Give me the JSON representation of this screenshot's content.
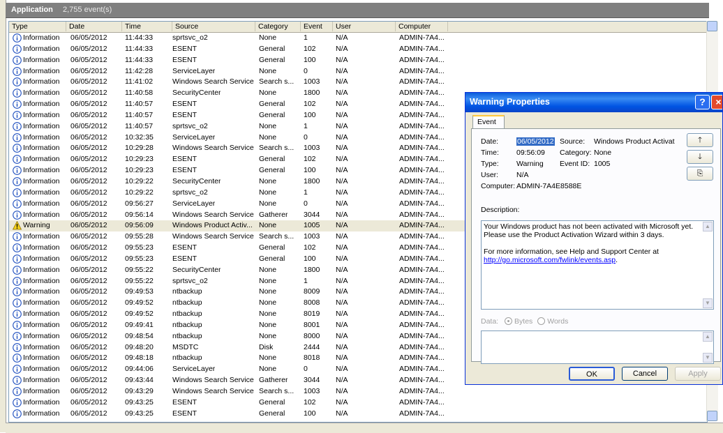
{
  "window": {
    "title": "Application",
    "count": "2,755 event(s)"
  },
  "columns": [
    "Type",
    "Date",
    "Time",
    "Source",
    "Category",
    "Event",
    "User",
    "Computer"
  ],
  "rows": [
    [
      "Information",
      "06/05/2012",
      "11:44:33",
      "sprtsvc_o2",
      "None",
      "1",
      "N/A",
      "ADMIN-7A4..."
    ],
    [
      "Information",
      "06/05/2012",
      "11:44:33",
      "ESENT",
      "General",
      "102",
      "N/A",
      "ADMIN-7A4..."
    ],
    [
      "Information",
      "06/05/2012",
      "11:44:33",
      "ESENT",
      "General",
      "100",
      "N/A",
      "ADMIN-7A4..."
    ],
    [
      "Information",
      "06/05/2012",
      "11:42:28",
      "ServiceLayer",
      "None",
      "0",
      "N/A",
      "ADMIN-7A4..."
    ],
    [
      "Information",
      "06/05/2012",
      "11:41:02",
      "Windows Search Service",
      "Search s...",
      "1003",
      "N/A",
      "ADMIN-7A4..."
    ],
    [
      "Information",
      "06/05/2012",
      "11:40:58",
      "SecurityCenter",
      "None",
      "1800",
      "N/A",
      "ADMIN-7A4..."
    ],
    [
      "Information",
      "06/05/2012",
      "11:40:57",
      "ESENT",
      "General",
      "102",
      "N/A",
      "ADMIN-7A4..."
    ],
    [
      "Information",
      "06/05/2012",
      "11:40:57",
      "ESENT",
      "General",
      "100",
      "N/A",
      "ADMIN-7A4..."
    ],
    [
      "Information",
      "06/05/2012",
      "11:40:57",
      "sprtsvc_o2",
      "None",
      "1",
      "N/A",
      "ADMIN-7A4..."
    ],
    [
      "Information",
      "06/05/2012",
      "10:32:35",
      "ServiceLayer",
      "None",
      "0",
      "N/A",
      "ADMIN-7A4..."
    ],
    [
      "Information",
      "06/05/2012",
      "10:29:28",
      "Windows Search Service",
      "Search s...",
      "1003",
      "N/A",
      "ADMIN-7A4..."
    ],
    [
      "Information",
      "06/05/2012",
      "10:29:23",
      "ESENT",
      "General",
      "102",
      "N/A",
      "ADMIN-7A4..."
    ],
    [
      "Information",
      "06/05/2012",
      "10:29:23",
      "ESENT",
      "General",
      "100",
      "N/A",
      "ADMIN-7A4..."
    ],
    [
      "Information",
      "06/05/2012",
      "10:29:22",
      "SecurityCenter",
      "None",
      "1800",
      "N/A",
      "ADMIN-7A4..."
    ],
    [
      "Information",
      "06/05/2012",
      "10:29:22",
      "sprtsvc_o2",
      "None",
      "1",
      "N/A",
      "ADMIN-7A4..."
    ],
    [
      "Information",
      "06/05/2012",
      "09:56:27",
      "ServiceLayer",
      "None",
      "0",
      "N/A",
      "ADMIN-7A4..."
    ],
    [
      "Information",
      "06/05/2012",
      "09:56:14",
      "Windows Search Service",
      "Gatherer",
      "3044",
      "N/A",
      "ADMIN-7A4..."
    ],
    [
      "Warning",
      "06/05/2012",
      "09:56:09",
      "Windows Product Activ...",
      "None",
      "1005",
      "N/A",
      "ADMIN-7A4..."
    ],
    [
      "Information",
      "06/05/2012",
      "09:55:28",
      "Windows Search Service",
      "Search s...",
      "1003",
      "N/A",
      "ADMIN-7A4..."
    ],
    [
      "Information",
      "06/05/2012",
      "09:55:23",
      "ESENT",
      "General",
      "102",
      "N/A",
      "ADMIN-7A4..."
    ],
    [
      "Information",
      "06/05/2012",
      "09:55:23",
      "ESENT",
      "General",
      "100",
      "N/A",
      "ADMIN-7A4..."
    ],
    [
      "Information",
      "06/05/2012",
      "09:55:22",
      "SecurityCenter",
      "None",
      "1800",
      "N/A",
      "ADMIN-7A4..."
    ],
    [
      "Information",
      "06/05/2012",
      "09:55:22",
      "sprtsvc_o2",
      "None",
      "1",
      "N/A",
      "ADMIN-7A4..."
    ],
    [
      "Information",
      "06/05/2012",
      "09:49:53",
      "ntbackup",
      "None",
      "8009",
      "N/A",
      "ADMIN-7A4..."
    ],
    [
      "Information",
      "06/05/2012",
      "09:49:52",
      "ntbackup",
      "None",
      "8008",
      "N/A",
      "ADMIN-7A4..."
    ],
    [
      "Information",
      "06/05/2012",
      "09:49:52",
      "ntbackup",
      "None",
      "8019",
      "N/A",
      "ADMIN-7A4..."
    ],
    [
      "Information",
      "06/05/2012",
      "09:49:41",
      "ntbackup",
      "None",
      "8001",
      "N/A",
      "ADMIN-7A4..."
    ],
    [
      "Information",
      "06/05/2012",
      "09:48:54",
      "ntbackup",
      "None",
      "8000",
      "N/A",
      "ADMIN-7A4..."
    ],
    [
      "Information",
      "06/05/2012",
      "09:48:20",
      "MSDTC",
      "Disk",
      "2444",
      "N/A",
      "ADMIN-7A4..."
    ],
    [
      "Information",
      "06/05/2012",
      "09:48:18",
      "ntbackup",
      "None",
      "8018",
      "N/A",
      "ADMIN-7A4..."
    ],
    [
      "Information",
      "06/05/2012",
      "09:44:06",
      "ServiceLayer",
      "None",
      "0",
      "N/A",
      "ADMIN-7A4..."
    ],
    [
      "Information",
      "06/05/2012",
      "09:43:44",
      "Windows Search Service",
      "Gatherer",
      "3044",
      "N/A",
      "ADMIN-7A4..."
    ],
    [
      "Information",
      "06/05/2012",
      "09:43:29",
      "Windows Search Service",
      "Search s...",
      "1003",
      "N/A",
      "ADMIN-7A4..."
    ],
    [
      "Information",
      "06/05/2012",
      "09:43:25",
      "ESENT",
      "General",
      "102",
      "N/A",
      "ADMIN-7A4..."
    ],
    [
      "Information",
      "06/05/2012",
      "09:43:25",
      "ESENT",
      "General",
      "100",
      "N/A",
      "ADMIN-7A4..."
    ]
  ],
  "selected_row": 17,
  "icons": {
    "info": "info-icon",
    "warning": "warning-icon"
  },
  "colors": {
    "title_blue": "#0054e3",
    "info_blue": "#1f4fbf",
    "warning_yellow": "#f5d31b",
    "selection": "#316ac5"
  },
  "dialog": {
    "title": "Warning Properties",
    "help_btn": "?",
    "close_btn": "×",
    "tab": "Event",
    "date_label": "Date:",
    "date": "06/05/2012",
    "source_label": "Source:",
    "source": "Windows Product Activat",
    "time_label": "Time:",
    "time": "09:56:09",
    "category_label": "Category:",
    "category": "None",
    "type_label": "Type:",
    "type": "Warning",
    "eventid_label": "Event ID:",
    "eventid": "1005",
    "user_label": "User:",
    "user": "N/A",
    "computer_label": "Computer:",
    "computer": "ADMIN-7A4E8588E",
    "up_btn": "🡑",
    "down_btn": "🡓",
    "copy_btn": "⎘",
    "description_label": "Description:",
    "description_1": "Your Windows product has not been activated with Microsoft yet. Please use the Product Activation Wizard within 3 days.",
    "description_2": "For more information, see Help and Support Center at",
    "description_link": "http://go.microsoft.com/fwlink/events.asp",
    "description_end": ".",
    "data_label": "Data:",
    "bytes_label": "Bytes",
    "words_label": "Words",
    "ok": "OK",
    "cancel": "Cancel",
    "apply": "Apply"
  }
}
